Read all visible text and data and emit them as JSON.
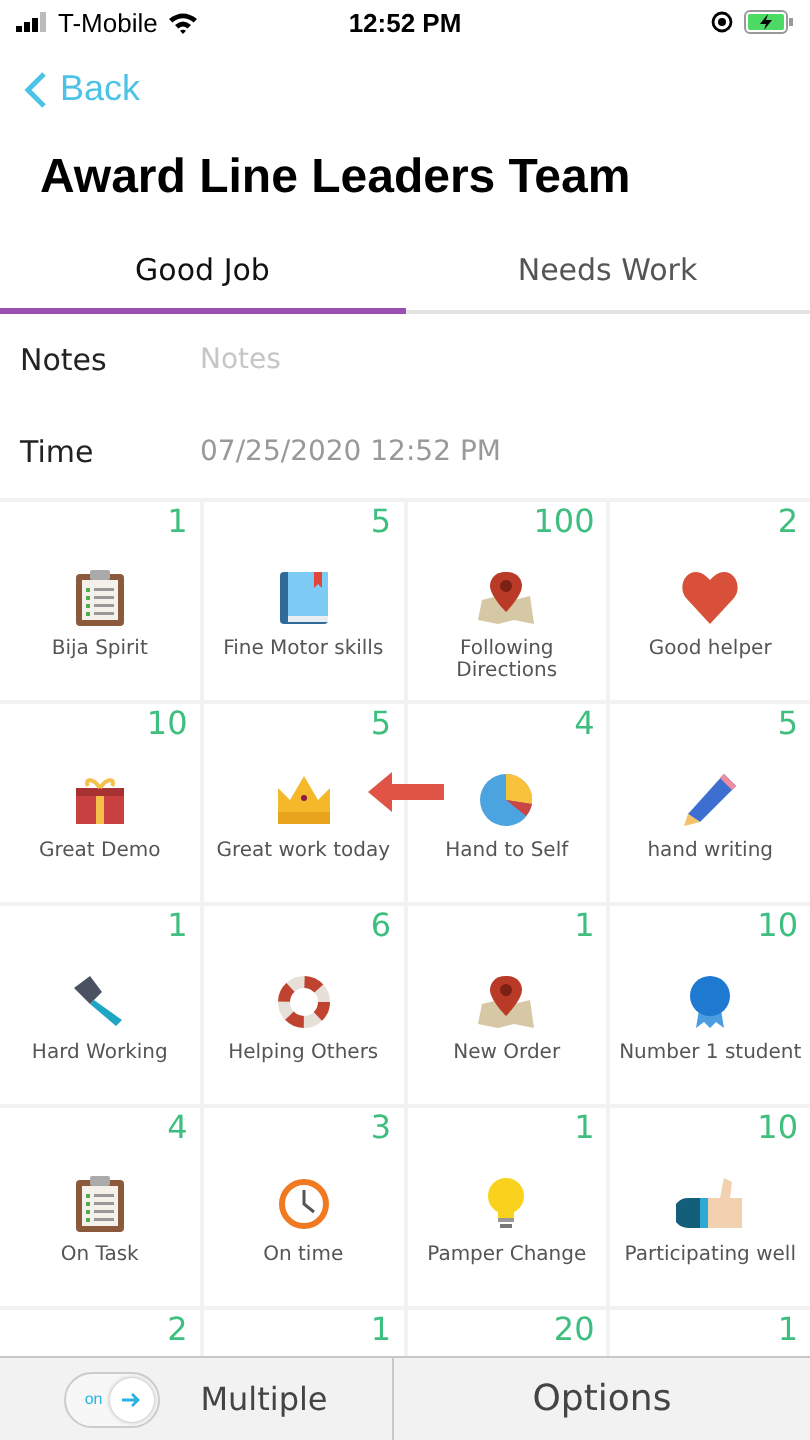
{
  "status_bar": {
    "carrier": "T-Mobile",
    "time": "12:52 PM"
  },
  "nav": {
    "back": "Back"
  },
  "title": "Award Line Leaders Team",
  "tabs": [
    {
      "label": "Good Job",
      "selected": true
    },
    {
      "label": "Needs Work",
      "selected": false
    }
  ],
  "form": [
    {
      "label": "Notes",
      "placeholder": "Notes"
    },
    {
      "label": "Time",
      "value": "07/25/2020 12:52 PM"
    }
  ],
  "awards": [
    {
      "count": "1",
      "name": "Bija Spirit"
    },
    {
      "count": "5",
      "name": "Fine Motor skills"
    },
    {
      "count": "100",
      "name": "Following Directions"
    },
    {
      "count": "2",
      "name": "Good helper"
    },
    {
      "count": "10",
      "name": "Great Demo"
    },
    {
      "count": "5",
      "name": "Great work today"
    },
    {
      "count": "4",
      "name": "Hand to Self"
    },
    {
      "count": "5",
      "name": "hand writing"
    },
    {
      "count": "1",
      "name": "Hard Working"
    },
    {
      "count": "6",
      "name": "Helping Others"
    },
    {
      "count": "1",
      "name": "New Order"
    },
    {
      "count": "10",
      "name": "Number 1 student"
    },
    {
      "count": "4",
      "name": "On Task"
    },
    {
      "count": "3",
      "name": "On time"
    },
    {
      "count": "1",
      "name": "Pamper Change"
    },
    {
      "count": "10",
      "name": "Participating well"
    },
    {
      "count": "2"
    },
    {
      "count": "1"
    },
    {
      "count": "20"
    },
    {
      "count": "1"
    }
  ],
  "bottom_bar": {
    "toggle": {
      "label": "on",
      "on": true
    },
    "multiple": "Multiple",
    "options": "Options"
  }
}
